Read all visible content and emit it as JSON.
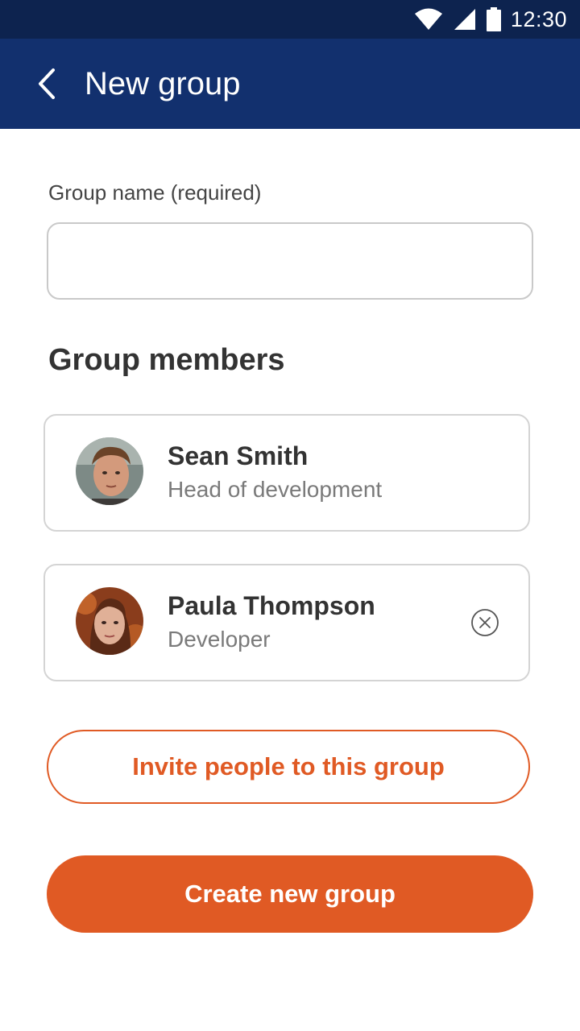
{
  "status_bar": {
    "time": "12:30",
    "icons": [
      "wifi-icon",
      "signal-icon",
      "battery-icon"
    ]
  },
  "app_bar": {
    "title": "New group",
    "back_icon": "chevron-left-icon"
  },
  "form": {
    "group_name_label": "Group name (required)",
    "group_name_value": "",
    "group_name_placeholder": ""
  },
  "members_section": {
    "title": "Group members",
    "members": [
      {
        "name": "Sean Smith",
        "role": "Head of development",
        "removable": false
      },
      {
        "name": "Paula Thompson",
        "role": "Developer",
        "removable": true
      }
    ]
  },
  "actions": {
    "invite_label": "Invite people to this group",
    "create_label": "Create new group"
  },
  "colors": {
    "status_bar": "#0d234f",
    "app_bar": "#12306e",
    "accent": "#e05a24",
    "text_primary": "#333333",
    "text_secondary": "#7a7a7a",
    "border": "#d4d4d4"
  }
}
